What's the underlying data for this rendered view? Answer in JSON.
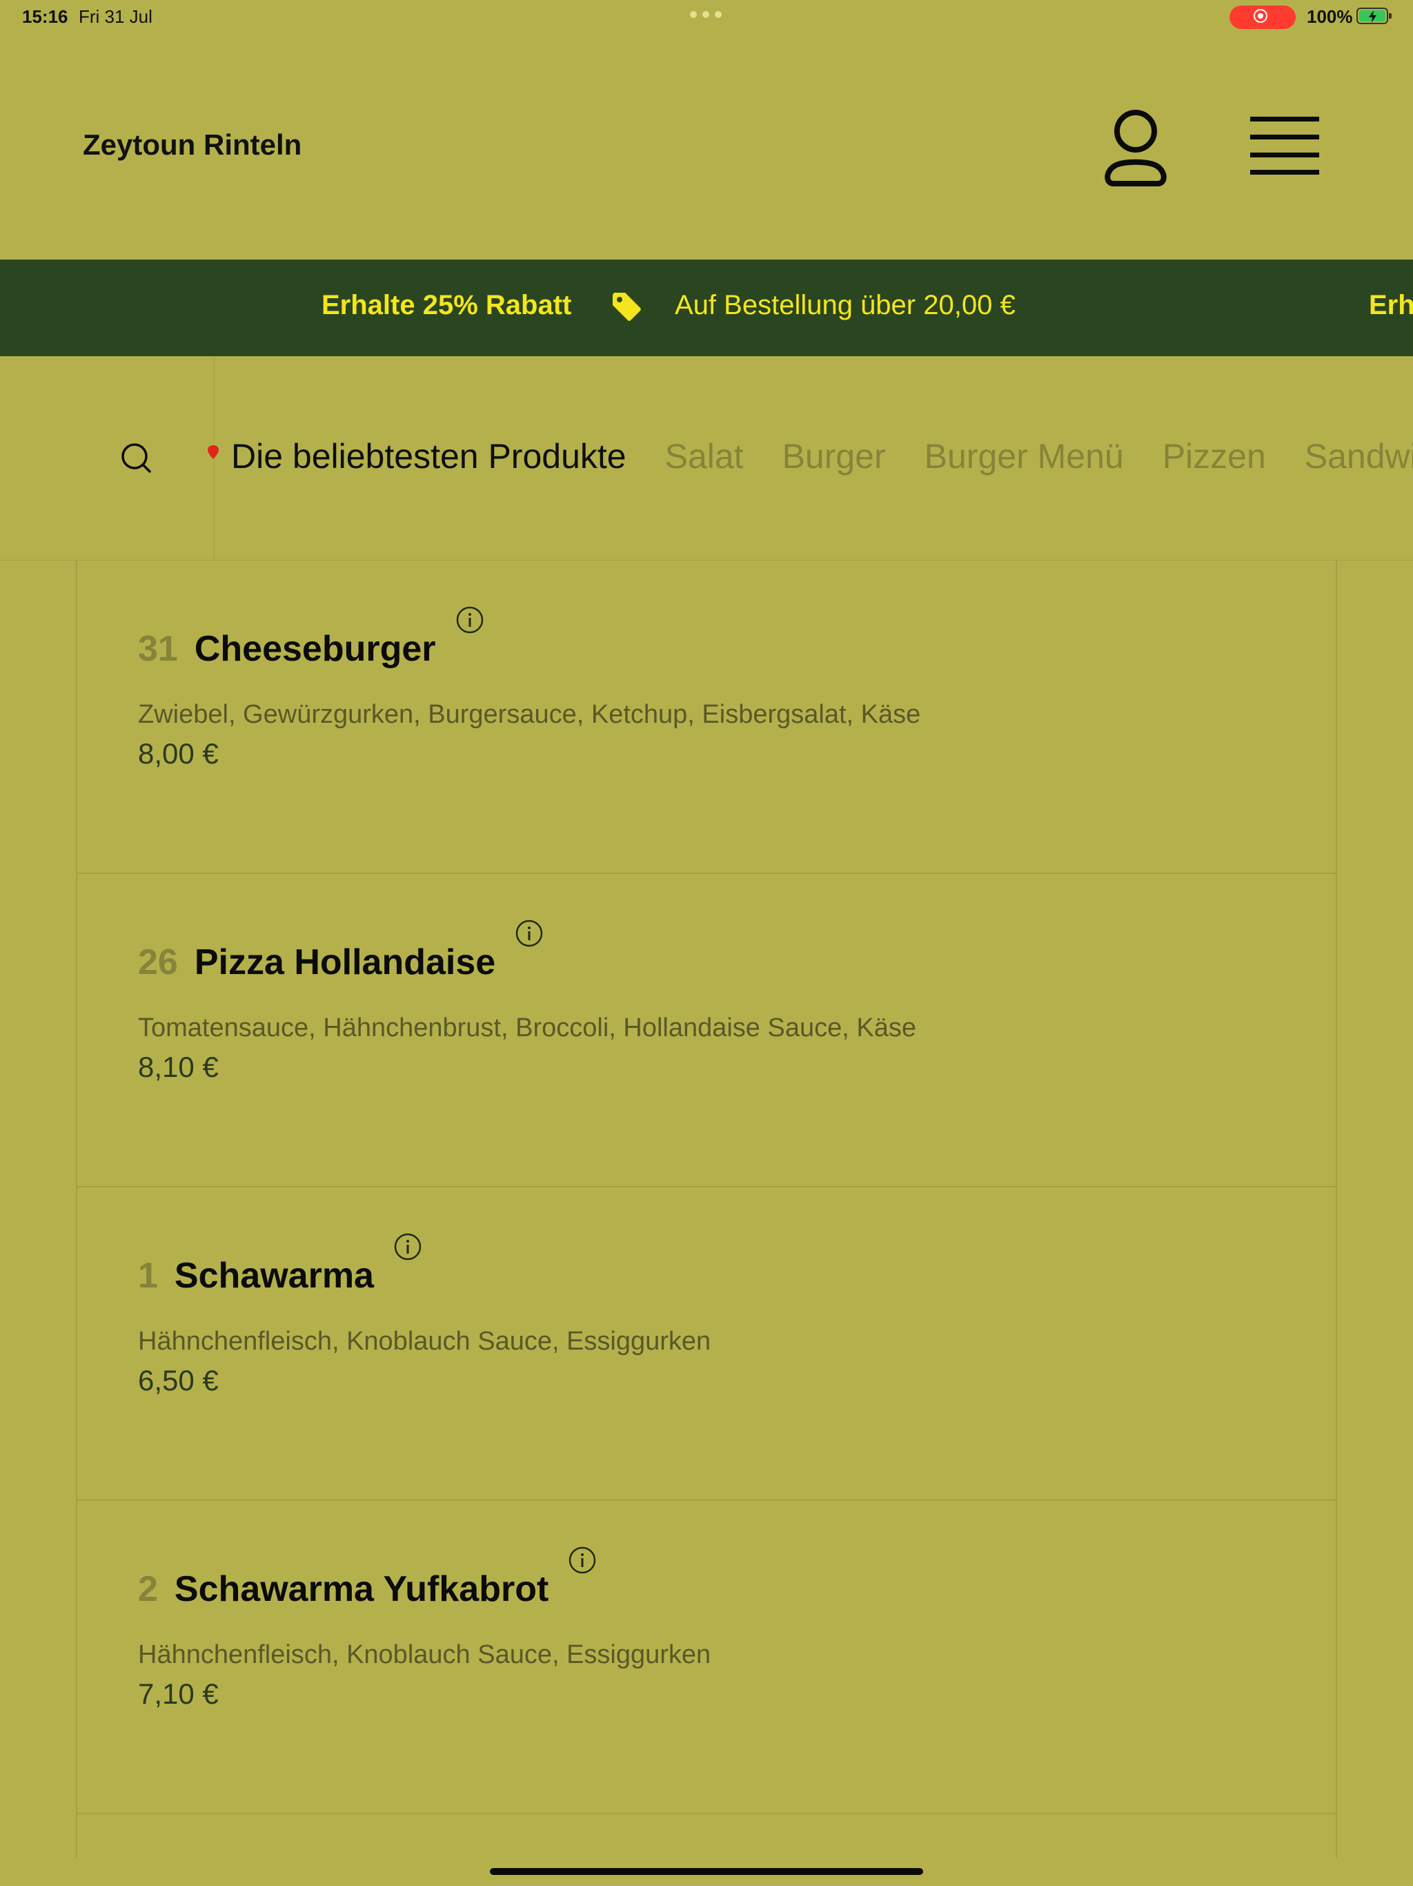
{
  "status_bar": {
    "time": "15:16",
    "date": "Fri 31 Jul",
    "battery_percent": "100%",
    "battery_level": 1.0,
    "recording_color": "#ff3b30"
  },
  "header": {
    "brand": "Zeytoun Rinteln",
    "user_icon": "user-icon",
    "menu_icon": "hamburger-menu-icon"
  },
  "promo": {
    "title": "Erhalte 25% Rabatt",
    "text": "Auf Bestellung über 20,00 €",
    "title_repeat": "Erh",
    "tag_icon": "tag-icon",
    "background_color": "#2a4620",
    "text_color": "#f5e51c"
  },
  "categories": {
    "search_icon": "search-icon",
    "items": [
      {
        "label": "Die beliebtesten Produkte",
        "active": true
      },
      {
        "label": "Salat",
        "active": false
      },
      {
        "label": "Burger",
        "active": false
      },
      {
        "label": "Burger Menü",
        "active": false
      },
      {
        "label": "Pizzen",
        "active": false
      },
      {
        "label": "Sandwiches",
        "active": false
      }
    ]
  },
  "products": [
    {
      "number": "31",
      "name": "Cheeseburger",
      "description": "Zwiebel, Gewürzgurken, Burgersauce, Ketchup, Eisbergsalat, Käse",
      "price": "8,00 €"
    },
    {
      "number": "26",
      "name": "Pizza Hollandaise",
      "description": "Tomatensauce, Hähnchenbrust, Broccoli, Hollandaise Sauce, Käse",
      "price": "8,10 €"
    },
    {
      "number": "1",
      "name": "Schawarma",
      "description": "Hähnchenfleisch, Knoblauch Sauce, Essiggurken",
      "price": "6,50 €"
    },
    {
      "number": "2",
      "name": "Schawarma Yufkabrot",
      "description": "Hähnchenfleisch, Knoblauch Sauce, Essiggurken",
      "price": "7,10 €"
    }
  ],
  "colors": {
    "background": "#b4b14c",
    "accent_dark": "#2a4620",
    "accent_yellow": "#f5e51c"
  }
}
